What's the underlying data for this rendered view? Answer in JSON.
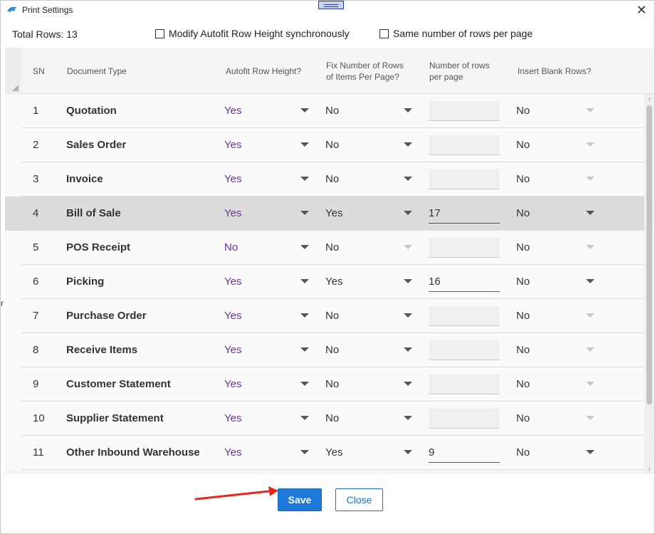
{
  "window": {
    "title": "Print Settings",
    "close_glyph": "✕"
  },
  "options": {
    "total_rows_label": "Total Rows: 13",
    "modify_autofit_label": "Modify Autofit Row Height synchronously",
    "same_rows_label": "Same number of rows per page"
  },
  "columns": {
    "sn": "SN",
    "document_type": "Document Type",
    "autofit": "Autofit Row Height?",
    "fix_number_line1": "Fix Number of Rows",
    "fix_number_line2": "of Items Per Page?",
    "rows_per_page_line1": "Number of rows",
    "rows_per_page_line2": "per page",
    "insert_blank": "Insert Blank Rows?"
  },
  "rows": [
    {
      "sn": "1",
      "document_type": "Quotation",
      "autofit": "Yes",
      "fix_number": "No",
      "rows_per_page": "",
      "insert_blank": "No"
    },
    {
      "sn": "2",
      "document_type": "Sales Order",
      "autofit": "Yes",
      "fix_number": "No",
      "rows_per_page": "",
      "insert_blank": "No"
    },
    {
      "sn": "3",
      "document_type": "Invoice",
      "autofit": "Yes",
      "fix_number": "No",
      "rows_per_page": "",
      "insert_blank": "No"
    },
    {
      "sn": "4",
      "document_type": "Bill of Sale",
      "autofit": "Yes",
      "fix_number": "Yes",
      "rows_per_page": "17",
      "insert_blank": "No"
    },
    {
      "sn": "5",
      "document_type": "POS Receipt",
      "autofit": "No",
      "fix_number": "No",
      "rows_per_page": "",
      "insert_blank": "No"
    },
    {
      "sn": "6",
      "document_type": "Picking",
      "autofit": "Yes",
      "fix_number": "Yes",
      "rows_per_page": "16",
      "insert_blank": "No"
    },
    {
      "sn": "7",
      "document_type": "Purchase Order",
      "autofit": "Yes",
      "fix_number": "No",
      "rows_per_page": "",
      "insert_blank": "No"
    },
    {
      "sn": "8",
      "document_type": "Receive Items",
      "autofit": "Yes",
      "fix_number": "No",
      "rows_per_page": "",
      "insert_blank": "No"
    },
    {
      "sn": "9",
      "document_type": "Customer Statement",
      "autofit": "Yes",
      "fix_number": "No",
      "rows_per_page": "",
      "insert_blank": "No"
    },
    {
      "sn": "10",
      "document_type": "Supplier Statement",
      "autofit": "Yes",
      "fix_number": "No",
      "rows_per_page": "",
      "insert_blank": "No"
    },
    {
      "sn": "11",
      "document_type": "Other Inbound Warehouse",
      "autofit": "Yes",
      "fix_number": "Yes",
      "rows_per_page": "9",
      "insert_blank": "No"
    }
  ],
  "buttons": {
    "save": "Save",
    "close": "Close"
  },
  "colors": {
    "accent": "#1e7ad9",
    "autofit_value": "#7030a0",
    "selected_row": "#dcdcdc",
    "annotation_arrow": "#e8261c"
  }
}
